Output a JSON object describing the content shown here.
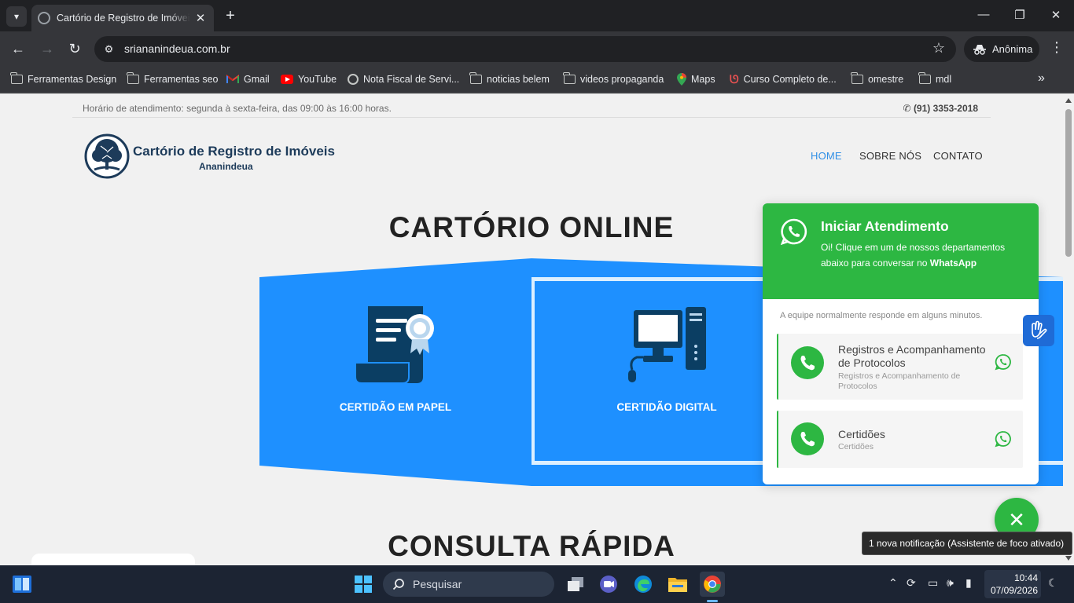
{
  "browser": {
    "tab_title": "Cartório de Registro de Imóveis",
    "url": "sriananindeua.com.br",
    "profile_label": "Anônima",
    "bookmarks": [
      {
        "label": "Ferramentas Design",
        "icon": "folder-icon"
      },
      {
        "label": "Ferramentas seo",
        "icon": "folder-icon"
      },
      {
        "label": "Gmail",
        "icon": "gmail-icon"
      },
      {
        "label": "YouTube",
        "icon": "youtube-icon"
      },
      {
        "label": "Nota Fiscal de Servi...",
        "icon": "globe-icon"
      },
      {
        "label": "noticias belem",
        "icon": "folder-icon"
      },
      {
        "label": "videos propaganda",
        "icon": "folder-icon"
      },
      {
        "label": "Maps",
        "icon": "maps-icon"
      },
      {
        "label": "Curso Completo de...",
        "icon": "udemy-icon"
      },
      {
        "label": "omestre",
        "icon": "folder-icon"
      },
      {
        "label": "mdl",
        "icon": "folder-icon"
      }
    ]
  },
  "site": {
    "hours_text": "Horário de atendimento: segunda à sexta-feira, das 09:00 às 16:00 horas.",
    "phone": "(91) 3353-2018",
    "logo_title": "Cartório de Registro de Imóveis",
    "logo_subtitle": "Ananindeua",
    "nav": [
      "HOME",
      "SOBRE NÓS",
      "CONTATO"
    ],
    "heading_online": "CARTÓRIO ONLINE",
    "card_paper": "CERTIDÃO EM PAPEL",
    "card_digital": "CERTIDÃO DIGITAL",
    "heading_consulta": "CONSULTA RÁPIDA"
  },
  "whatsapp": {
    "title": "Iniciar Atendimento",
    "desc_before": "Oi! Clique em um de nossos departamentos abaixo para conversar no",
    "desc_bold": "WhatsApp",
    "note": "A equipe normalmente responde em alguns minutos.",
    "items": [
      {
        "name": "Registros e Acompanhamento de Protocolos",
        "sub": "Registros e Acompanhamento de Protocolos"
      },
      {
        "name": "Certidões",
        "sub": "Certidões"
      }
    ]
  },
  "notification": "1 nova notificação (Assistente de foco ativado)",
  "taskbar": {
    "search_label": "Pesquisar",
    "time": "10:44",
    "date": "07/09/2026"
  },
  "colors": {
    "whatsapp_green": "#2db742",
    "accent_blue": "#2f8fe6",
    "card_blue": "#1e90ff"
  }
}
